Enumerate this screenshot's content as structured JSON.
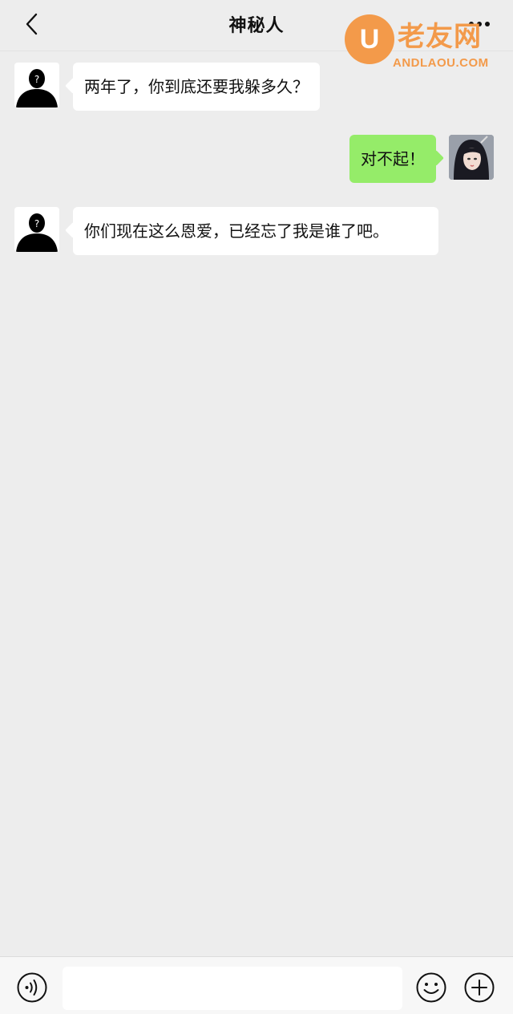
{
  "header": {
    "title": "神秘人",
    "back_icon": "chevron-left-icon",
    "more_icon": "more-dots-icon"
  },
  "watermark": {
    "badge_letter": "U",
    "brand_cn": "老友网",
    "brand_en": "ANDLAOU.COM",
    "color": "#f39a4a"
  },
  "messages": [
    {
      "direction": "incoming",
      "sender_avatar": "mystery-person-avatar",
      "text": "两年了，你到底还要我躲多久？"
    },
    {
      "direction": "outgoing",
      "sender_avatar": "user-avatar",
      "text": "对不起！"
    },
    {
      "direction": "incoming",
      "sender_avatar": "mystery-person-avatar",
      "text": "你们现在这么恩爱，已经忘了我是谁了吧。"
    }
  ],
  "input_bar": {
    "voice_icon": "voice-icon",
    "message_value": "",
    "emoji_icon": "emoji-icon",
    "plus_icon": "plus-icon"
  },
  "colors": {
    "background": "#ededed",
    "incoming_bubble": "#ffffff",
    "outgoing_bubble": "#95ec69"
  }
}
